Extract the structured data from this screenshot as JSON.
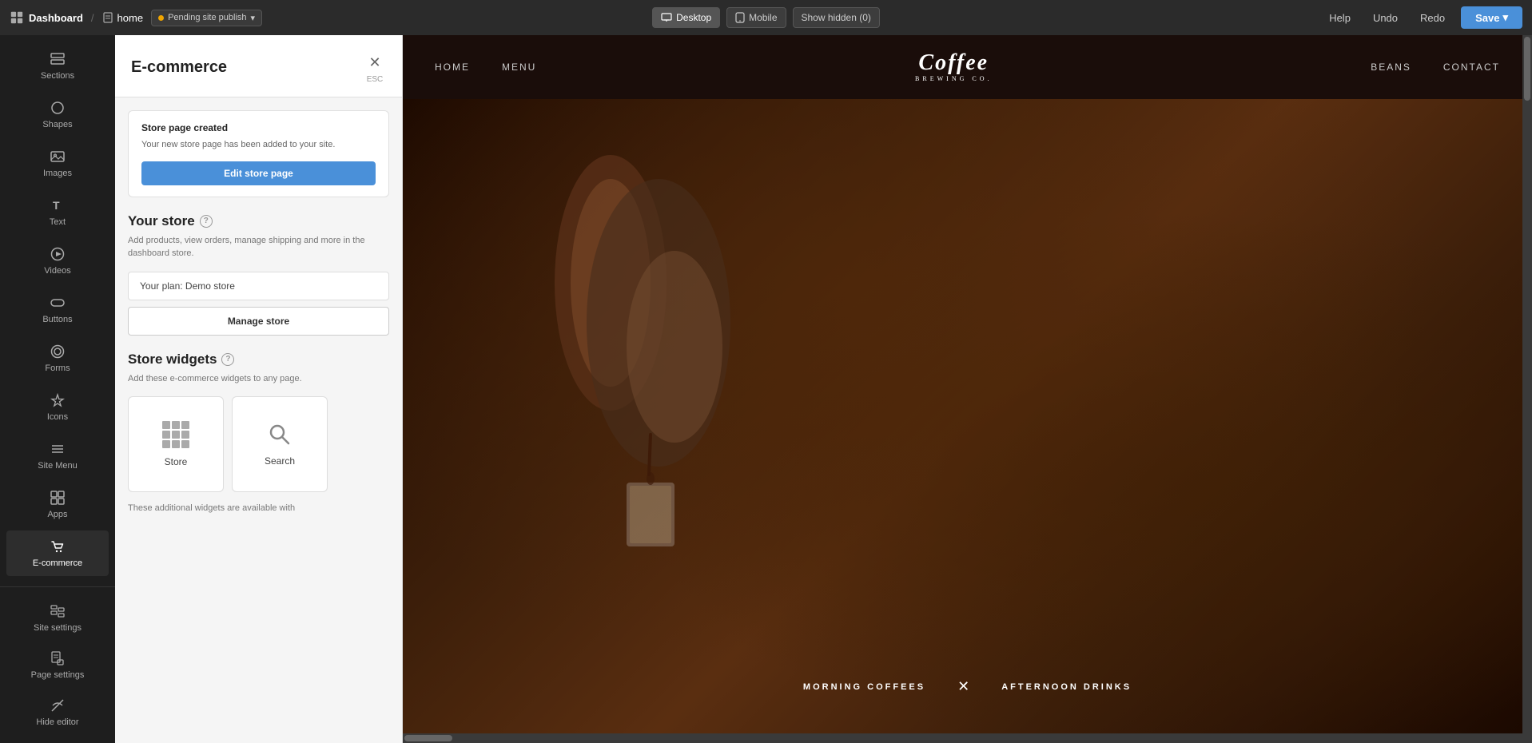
{
  "topbar": {
    "brand_label": "Dashboard",
    "page_label": "home",
    "pending_label": "Pending site publish",
    "view_desktop_label": "Desktop",
    "view_mobile_label": "Mobile",
    "show_hidden_label": "Show hidden (0)",
    "help_label": "Help",
    "undo_label": "Undo",
    "redo_label": "Redo",
    "save_label": "Save",
    "save_chevron": "▾"
  },
  "sidebar": {
    "items": [
      {
        "id": "sections",
        "label": "Sections"
      },
      {
        "id": "shapes",
        "label": "Shapes"
      },
      {
        "id": "images",
        "label": "Images"
      },
      {
        "id": "text",
        "label": "Text"
      },
      {
        "id": "videos",
        "label": "Videos"
      },
      {
        "id": "buttons",
        "label": "Buttons"
      },
      {
        "id": "forms",
        "label": "Forms"
      },
      {
        "id": "icons",
        "label": "Icons"
      },
      {
        "id": "sitemenu",
        "label": "Site Menu"
      },
      {
        "id": "apps",
        "label": "Apps"
      },
      {
        "id": "ecommerce",
        "label": "E-commerce"
      }
    ],
    "bottom_items": [
      {
        "id": "site-settings",
        "label": "Site settings"
      },
      {
        "id": "page-settings",
        "label": "Page settings"
      },
      {
        "id": "hide-editor",
        "label": "Hide editor"
      }
    ]
  },
  "panel": {
    "title": "E-commerce",
    "close_esc": "ESC",
    "notice": {
      "title": "Store page created",
      "text": "Your new store page has been added to your site.",
      "edit_btn": "Edit store page"
    },
    "your_store": {
      "title": "Your store",
      "help_icon": "?",
      "desc": "Add products, view orders, manage shipping and more in the dashboard store.",
      "plan_label": "Your plan: Demo store",
      "manage_btn": "Manage store"
    },
    "store_widgets": {
      "title": "Store widgets",
      "help_icon": "?",
      "desc": "Add these e-commerce widgets to any page.",
      "widgets": [
        {
          "id": "store",
          "label": "Store"
        },
        {
          "id": "search",
          "label": "Search"
        }
      ],
      "footer_text": "These additional widgets are available with"
    }
  },
  "preview": {
    "nav_links_left": [
      "HOME",
      "MENU"
    ],
    "nav_logo_line1": "Coffee",
    "nav_logo_line2": "BREWING CO.",
    "nav_links_right": [
      "BEANS",
      "CONTACT"
    ],
    "hero_tab1": "ORNING COFFEES",
    "hero_tab_sep": "✕",
    "hero_tab2": "AFTERNOON DRINKS"
  },
  "colors": {
    "accent_blue": "#4a90d9",
    "sidebar_bg": "#1e1e1e",
    "topbar_bg": "#2b2b2b",
    "panel_bg": "#f5f5f5",
    "coffee_dark": "#1a0d0a"
  }
}
